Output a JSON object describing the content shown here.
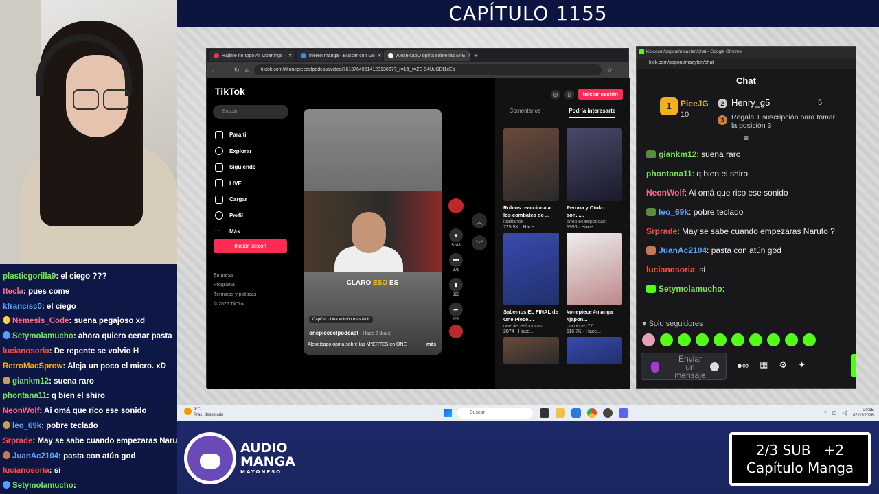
{
  "title": "CAPÍTULO 1155",
  "browser": {
    "tabs": [
      {
        "label": "Hajime no Ippo All Openings ·"
      },
      {
        "label": "frieren manga - Buscar con Go"
      },
      {
        "label": "AlexelcapO opina sobre las M*E"
      }
    ],
    "url": "tiktok.com/@onepieceelpodcast/video/7613764951412313667?_r=1&_t=ZS-94UuGDf1cEa"
  },
  "tiktok": {
    "logo": "TikTok",
    "search_placeholder": "Buscar",
    "nav": [
      {
        "label": "Para ti",
        "icon": "home-icon"
      },
      {
        "label": "Explorar",
        "icon": "compass-icon"
      },
      {
        "label": "Siguiendo",
        "icon": "following-icon"
      },
      {
        "label": "LIVE",
        "icon": "live-icon"
      },
      {
        "label": "Cargar",
        "icon": "upload-icon"
      },
      {
        "label": "Perfil",
        "icon": "profile-icon"
      },
      {
        "label": "Más",
        "icon": "more-icon"
      }
    ],
    "login_label": "Iniciar sesión",
    "footer": [
      "Empresa",
      "Programa",
      "Términos y políticas",
      "© 2026 TikTok"
    ],
    "video": {
      "caption_pre": "CLARO ",
      "caption_hl": "ESO",
      "caption_post": " ES",
      "capcut": "CapCut · Una edición más fácil",
      "author": "onepieceelpodcast",
      "ago": " · Hace 2 día(s)",
      "desc": "Alexelcapo opina sobre las M*ERTES en ONE",
      "more": "más"
    },
    "counts": {
      "likes": "5288",
      "comments": "279",
      "saves": "383",
      "shares": "209"
    },
    "right_tabs": [
      "Comentarios",
      "Podría interesarte"
    ],
    "cards": [
      {
        "title": "Rubius reacciona a los combates de ...",
        "author": "ibaillanos",
        "stats": "725.5K · Hace..."
      },
      {
        "title": "Perona y Otoko son......",
        "author": "onepieceelpodcast",
        "stats": "1956 · Hace..."
      },
      {
        "title": "Sabemos EL FINAL de One Piece....",
        "author": "onepieceelpodcast",
        "stats": "2874 · Hace..."
      },
      {
        "title": "#onepiece #manga #japon...",
        "author": "pacohdez77",
        "stats": "116.7K · Hace..."
      }
    ]
  },
  "kick": {
    "window_title": "kick.com/popout/maaylen/chat - Google Chrome",
    "url": "kick.com/popout/maaylen/chat",
    "header": "Chat",
    "leaderboard": {
      "first": {
        "rank": "1",
        "name": "PieeJG",
        "points": "10"
      },
      "second": {
        "rank": "2",
        "name": "Henry_g5",
        "points": "5"
      },
      "third": {
        "rank": "3",
        "desc": "Regala 1 suscripción para tomar la posición 3"
      }
    },
    "messages": [
      {
        "user": "giankm12",
        "text": ": suena raro",
        "color": "#7be05a",
        "badge": "#5a8a3a"
      },
      {
        "user": "phontana11",
        "text": ": q bien el shiro",
        "color": "#7be05a",
        "badge": ""
      },
      {
        "user": "NeonWolf",
        "text": ": Ai omá que rico ese sonido",
        "color": "#ff6b8b",
        "badge": ""
      },
      {
        "user": "leo_69k",
        "text": ": pobre teclado",
        "color": "#5aa8ff",
        "badge": "#5a8a3a"
      },
      {
        "user": "Srprade",
        "text": ": May se sabe cuando empezaras Naruto ?",
        "color": "#ff4a4a",
        "badge": ""
      },
      {
        "user": "JuanAc2104",
        "text": ": pasta con atún god",
        "color": "#5aa8ff",
        "badge": "#c07a5a"
      },
      {
        "user": "lucianosoria",
        "text": ": si",
        "color": "#ff4a4a",
        "badge": ""
      },
      {
        "user": "Setymolamucho",
        "text": ":",
        "color": "#7be05a",
        "badge": "#53fc18"
      }
    ],
    "followers_only": "Solo seguidores",
    "input_placeholder": "Enviar un mensaje"
  },
  "taskbar": {
    "weather_temp": "9°C",
    "weather_desc": "Prac. despejado",
    "search": "Buscar",
    "time": "20:15",
    "date": "07/03/2026"
  },
  "overlay_chat": [
    {
      "user": "plasticgorilla9",
      "text": ": el ciego ???",
      "color": "#7be05a",
      "badge": ""
    },
    {
      "user": "ttecla",
      "text": ": pues come",
      "color": "#ff6b8b",
      "badge": ""
    },
    {
      "user": "kfrancisc0",
      "text": ": el ciego",
      "color": "#5aa8ff",
      "badge": ""
    },
    {
      "user": "Nemesis_Code",
      "text": ": suena pegajoso xd",
      "color": "#ff6b8b",
      "badge": "#f2d04a"
    },
    {
      "user": "Setymolamucho",
      "text": ": ahora quiero cenar pasta",
      "color": "#7be05a",
      "badge": "#53a0fc"
    },
    {
      "user": "lucianosoria",
      "text": ": De repente se volvio H",
      "color": "#ff4a4a",
      "badge": ""
    },
    {
      "user": "RetroMacSprow",
      "text": ": Aleja un poco el micro. xD",
      "color": "#f2b01e",
      "badge": ""
    },
    {
      "user": "giankm12",
      "text": ": suena raro",
      "color": "#7be05a",
      "badge": "#c0a060"
    },
    {
      "user": "phontana11",
      "text": ": q bien el shiro",
      "color": "#7be05a",
      "badge": ""
    },
    {
      "user": "NeonWolf",
      "text": ": Ai omá que rico ese sonido",
      "color": "#ff6b8b",
      "badge": ""
    },
    {
      "user": "leo_69k",
      "text": ": pobre teclado",
      "color": "#5aa8ff",
      "badge": "#c0a060"
    },
    {
      "user": "Srprade",
      "text": ": May se sabe cuando empezaras Naru",
      "color": "#ff4a4a",
      "badge": ""
    },
    {
      "user": "JuanAc2104",
      "text": ": pasta con atún god",
      "color": "#5aa8ff",
      "badge": "#c07a5a"
    },
    {
      "user": "lucianosoria",
      "text": ": si",
      "color": "#ff4a4a",
      "badge": ""
    },
    {
      "user": "Setymolamucho",
      "text": ":",
      "color": "#7be05a",
      "badge": "#53a0fc"
    }
  ],
  "brand": {
    "line1": "AUDIO",
    "line2": "MANGA",
    "line3": "MAYONESO"
  },
  "sub_goal": {
    "line1": "2/3 SUB   +2",
    "line2": "Capítulo Manga"
  }
}
